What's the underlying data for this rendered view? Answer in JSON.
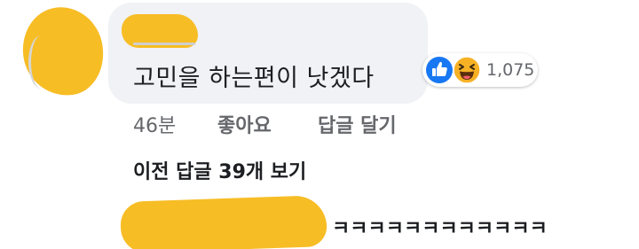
{
  "comment": {
    "text": "고민을 하는편이 낫겠다",
    "reaction_count": "1,075",
    "reaction_icons": [
      "like-icon",
      "haha-icon"
    ]
  },
  "actions": {
    "time": "46분",
    "like_label": "좋아요",
    "reply_label": "답글 달기"
  },
  "previous_replies_label": "이전 답글 39개 보기",
  "reply": {
    "text": "ㅋㅋㅋㅋㅋㅋㅋㅋㅋㅋㅋㅋ"
  },
  "colors": {
    "bubble": "#f0f2f5",
    "redaction": "#f7bd25",
    "like_blue": "#1877f2",
    "secondary_text": "#65676b"
  }
}
